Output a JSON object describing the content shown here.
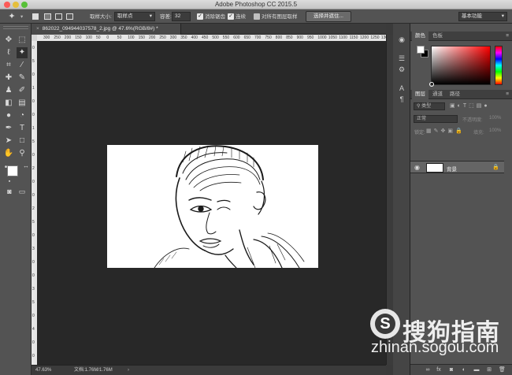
{
  "window": {
    "title": "Adobe Photoshop CC 2015.5",
    "traffic_colors": [
      "#fc5b57",
      "#e5bf3c",
      "#57c038"
    ]
  },
  "options_bar": {
    "sample_size_label": "取样大小:",
    "sample_size_value": "取样点",
    "tolerance_label": "容差:",
    "tolerance_value": "32",
    "antialias_label": "消除锯齿",
    "contiguous_label": "连续",
    "sample_all_label": "对所有图层取样",
    "select_mask_button": "选择并遮住...",
    "workspace_value": "基本功能"
  },
  "document": {
    "tab_title": "862022_094944037578_2.jpg @ 47.6%(RGB/8#) *",
    "ruler_top_ticks": [
      "300",
      "250",
      "200",
      "150",
      "100",
      "50",
      "0",
      "50",
      "100",
      "150",
      "200",
      "250",
      "300",
      "350",
      "400",
      "450",
      "500",
      "550",
      "600",
      "650",
      "700",
      "750",
      "800",
      "850",
      "900",
      "950",
      "1000",
      "1050",
      "1100",
      "1150",
      "1200",
      "1250",
      "1300"
    ],
    "ruler_left_ticks": [
      "0",
      "5",
      "0",
      "1",
      "0",
      "0",
      "1",
      "5",
      "0",
      "2",
      "0",
      "0",
      "2",
      "5",
      "0",
      "3",
      "0",
      "0",
      "3",
      "5",
      "0",
      "4",
      "0",
      "0"
    ],
    "image_description_colors": {
      "background": "#ffffff",
      "ink": "#1a1a1a"
    }
  },
  "status_bar": {
    "zoom": "47.63%",
    "doc_info": "文档:1.76M/1.76M"
  },
  "panels": {
    "color_tabs": [
      "颜色",
      "色板"
    ],
    "layers_tabs": [
      "图层",
      "通道",
      "路径"
    ],
    "kind_filter": "类型",
    "blend_mode": "正常",
    "opacity_label": "不透明度:",
    "opacity_value": "100%",
    "lock_label": "锁定:",
    "fill_label": "填充:",
    "fill_value": "100%",
    "layer_name": "背景",
    "colors": {
      "hue_top": "#ff0000",
      "picker_white": "#ffffff",
      "picker_black": "#000000"
    }
  },
  "watermark": {
    "brand": "搜狗指南",
    "url": "zhinan.sogou.com"
  }
}
